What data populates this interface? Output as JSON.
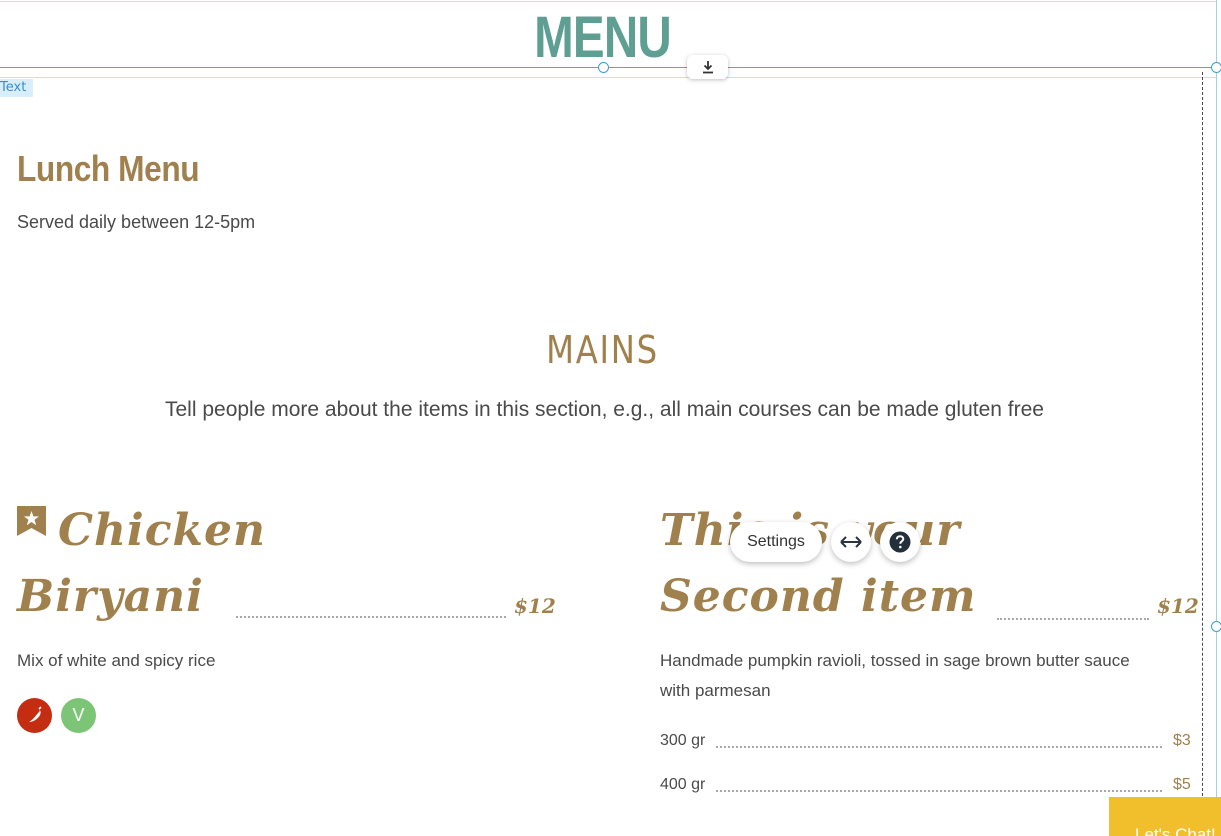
{
  "header": {
    "title": "MENU"
  },
  "editor": {
    "text_tag": "Text"
  },
  "section": {
    "title": "Lunch Menu",
    "subtitle": "Served daily between 12-5pm"
  },
  "mains": {
    "title": "MAINS",
    "description": "Tell people more about the items in this section, e.g., all main courses can be made gluten free"
  },
  "items": [
    {
      "name_line1": "Chicken",
      "name_line2": "Biryani",
      "price": "$12",
      "description": "Mix of white and spicy rice",
      "badge_icon": "star-ribbon-icon",
      "tags": [
        "chili-pepper-icon",
        "V"
      ]
    },
    {
      "name_line1": "This is your",
      "name_line2": "Second item",
      "price": "$12",
      "description_line1": "Handmade pumpkin ravioli, tossed in sage brown butter sauce",
      "description_line2": "with parmesan",
      "variants": [
        {
          "label": "300 gr",
          "price": "$3"
        },
        {
          "label": "400 gr",
          "price": "$5"
        }
      ]
    }
  ],
  "toolbar": {
    "settings_label": "Settings",
    "stretch_icon": "stretch-arrows-icon",
    "help_icon": "help-icon"
  },
  "chat": {
    "label": "Let's Chat!"
  },
  "colors": {
    "brand_teal": "#5e9e93",
    "gold": "#a0804d",
    "spicy_red": "#c42d12",
    "veg_green": "#7cc576",
    "chat_yellow": "#f0bf2b"
  }
}
